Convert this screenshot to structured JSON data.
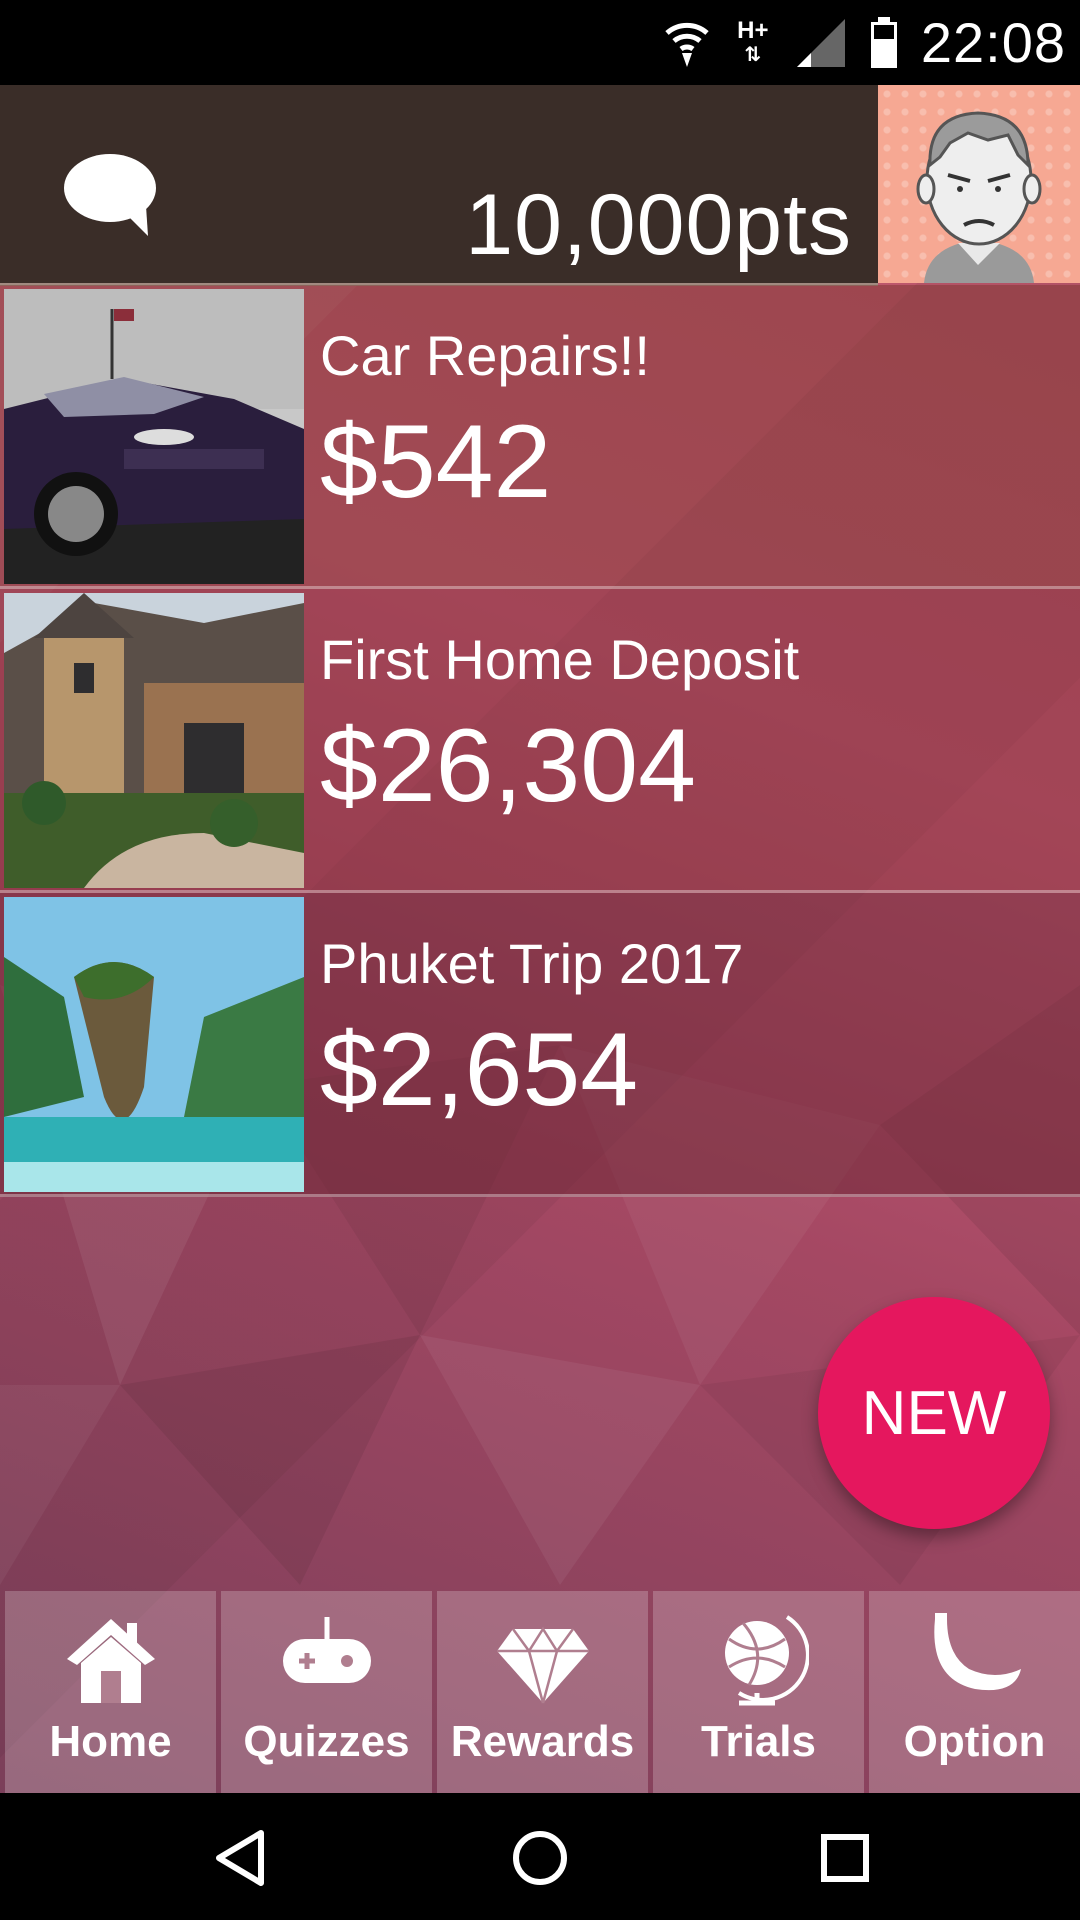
{
  "status_bar": {
    "time": "22:08",
    "network": "H+"
  },
  "header": {
    "points": "10,000pts"
  },
  "goals": [
    {
      "title": "Car Repairs!!",
      "amount": "$542"
    },
    {
      "title": "First Home Deposit",
      "amount": "$26,304"
    },
    {
      "title": "Phuket Trip 2017",
      "amount": "$2,654"
    }
  ],
  "fab": {
    "label": "NEW",
    "color": "#e5175e"
  },
  "bottom_nav": [
    {
      "label": "Home",
      "icon": "home-icon"
    },
    {
      "label": "Quizzes",
      "icon": "gamepad-icon"
    },
    {
      "label": "Rewards",
      "icon": "diamond-icon"
    },
    {
      "label": "Trials",
      "icon": "globe-icon"
    },
    {
      "label": "Option",
      "icon": "banana-icon"
    }
  ]
}
